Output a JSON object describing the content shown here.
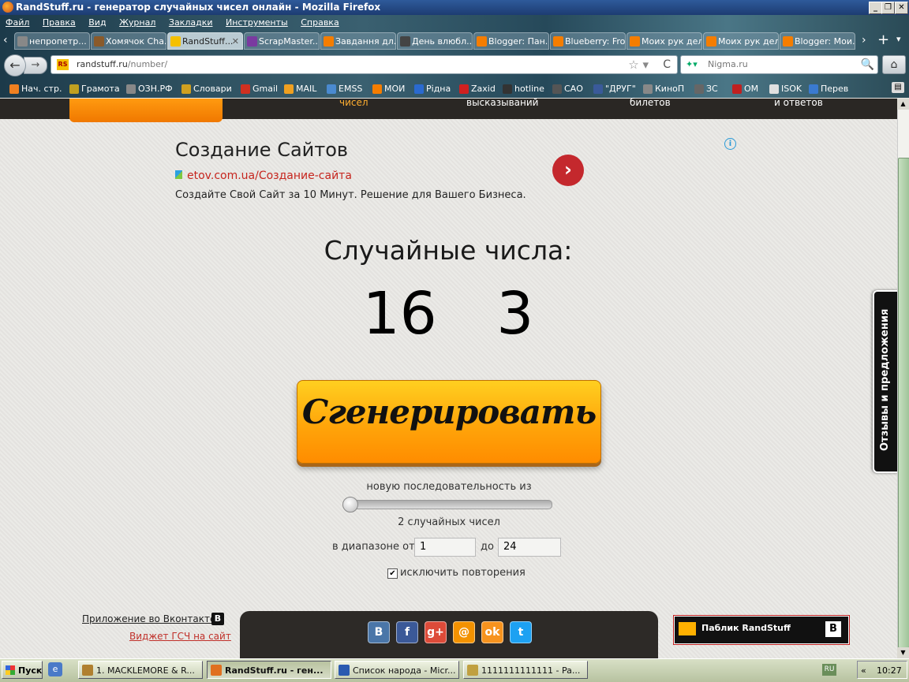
{
  "window": {
    "title": "RandStuff.ru - генератор случайных чисел онлайн - Mozilla Firefox",
    "controls": [
      "_",
      "❐",
      "✕"
    ]
  },
  "menu": [
    "Файл",
    "Правка",
    "Вид",
    "Журнал",
    "Закладки",
    "Инструменты",
    "Справка"
  ],
  "tabs": [
    {
      "label": "непропетр...",
      "color": "#888888"
    },
    {
      "label": "Хомячок Cha...",
      "color": "#8a5a2a"
    },
    {
      "label": "RandStuff...",
      "color": "#f5c000",
      "active": true,
      "close": "✕"
    },
    {
      "label": "ScrapMaster...",
      "color": "#7a3aa0"
    },
    {
      "label": "Завдання дл...",
      "color": "#f57d00"
    },
    {
      "label": "День влюбл...",
      "color": "#444444"
    },
    {
      "label": "Blogger: Пан...",
      "color": "#f57d00"
    },
    {
      "label": "Blueberry: Fro...",
      "color": "#f57d00"
    },
    {
      "label": "Моих рук дел...",
      "color": "#f57d00"
    },
    {
      "label": "Моих рук дел...",
      "color": "#f57d00"
    },
    {
      "label": "Blogger: Мои...",
      "color": "#f57d00"
    }
  ],
  "nav": {
    "back": "←",
    "forward": "→",
    "url_domain": "randstuff.ru",
    "url_path": "/number/",
    "site_icon": "RS",
    "star": "☆ ▾",
    "reload": "C",
    "search_placeholder": "Nigma.ru",
    "search_engine": "✦▾",
    "search_icon": "🔍",
    "home": "⌂"
  },
  "bookmarks": [
    {
      "label": "Нач. стр.",
      "color": "#f08020"
    },
    {
      "label": "Грамота",
      "color": "#c0a020"
    },
    {
      "label": "ОЗН.РФ",
      "color": "#888888"
    },
    {
      "label": "Словари",
      "color": "#d0a020"
    },
    {
      "label": "Gmail",
      "color": "#d03020"
    },
    {
      "label": "MAIL",
      "color": "#f0a020"
    },
    {
      "label": "EMSS",
      "color": "#4a8ad0"
    },
    {
      "label": "МОИ",
      "color": "#f57d00"
    },
    {
      "label": "Рідна",
      "color": "#2a6ad0"
    },
    {
      "label": "Zaxid",
      "color": "#d02020"
    },
    {
      "label": "hotline",
      "color": "#333333"
    },
    {
      "label": "САО",
      "color": "#555555"
    },
    {
      "label": "\"ДРУГ\"",
      "color": "#3a5a9a"
    },
    {
      "label": "КиноП",
      "color": "#888888"
    },
    {
      "label": "ЗС",
      "color": "#666666"
    },
    {
      "label": "ОМ",
      "color": "#c02020"
    },
    {
      "label": "ISOK",
      "color": "#e0e0e0"
    },
    {
      "label": "Перев",
      "color": "#3a7ad0"
    }
  ],
  "site_nav": [
    "чисел",
    "высказываний",
    "билетов",
    "и ответов"
  ],
  "ad": {
    "title": "Создание Сайтов",
    "url": "etov.com.ua/Создание-сайта",
    "description": "Создайте Свой Сайт за 10 Минут. Решение для Вашего Бизнеса.",
    "arrow": "›",
    "info": "i"
  },
  "generator": {
    "heading": "Случайные числа:",
    "numbers": [
      "16",
      "3"
    ],
    "button_label": "Сгенерировать",
    "sequence_label": "новую последовательность из",
    "count_label": "2 случайных чисел",
    "range_label": "в диапазоне от",
    "range_from": "1",
    "to_label": "до",
    "range_to": "24",
    "exclude_checked": true,
    "exclude_label": "исключить повторения",
    "check_mark": "✔"
  },
  "feedback": "Отзывы и предложения",
  "footer": {
    "vk_app": "Приложение во Вконтакте",
    "vk_glyph": "B",
    "widget": "Виджет ГСЧ на сайт",
    "social": [
      {
        "name": "vk",
        "glyph": "B",
        "color": "#4a76a8"
      },
      {
        "name": "facebook",
        "glyph": "f",
        "color": "#3b5998"
      },
      {
        "name": "googleplus",
        "glyph": "g+",
        "color": "#dd4b39"
      },
      {
        "name": "mail",
        "glyph": "@",
        "color": "#f39200"
      },
      {
        "name": "odnoklassniki",
        "glyph": "ok",
        "color": "#f7931e"
      },
      {
        "name": "twitter",
        "glyph": "t",
        "color": "#1da1f2"
      }
    ],
    "public_label": "Паблик RandStuff",
    "public_vk": "B"
  },
  "taskbar": {
    "start": "Пуск",
    "quicklaunch": "e",
    "items": [
      {
        "label": "1. MACKLEMORE & R...",
        "color": "#b08030"
      },
      {
        "label": "RandStuff.ru - ген...",
        "color": "#e07020",
        "active": true
      },
      {
        "label": "Список народа - Micr...",
        "color": "#2a5ab0"
      },
      {
        "label": "1111111111111 - Pa...",
        "color": "#c0a040"
      }
    ],
    "lang": "RU",
    "chevron": "«",
    "clock": "10:27"
  }
}
